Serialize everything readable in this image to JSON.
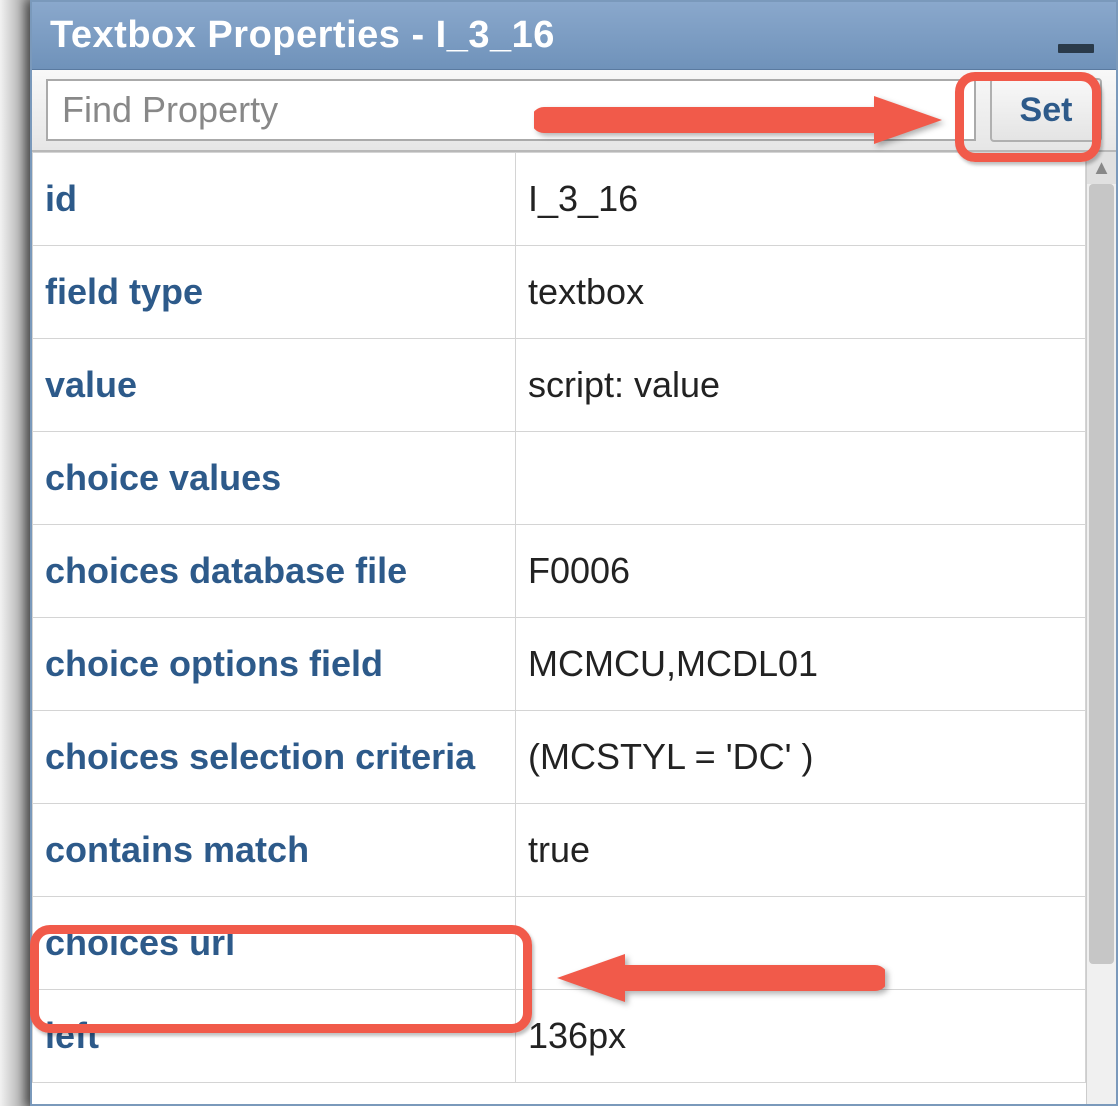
{
  "window": {
    "title": "Textbox Properties - I_3_16"
  },
  "toolbar": {
    "find_placeholder": "Find Property",
    "set_label": "Set"
  },
  "properties": [
    {
      "name": "id",
      "value": "I_3_16"
    },
    {
      "name": "field type",
      "value": "textbox"
    },
    {
      "name": "value",
      "value": "script: value"
    },
    {
      "name": "choice values",
      "value": ""
    },
    {
      "name": "choices database file",
      "value": "F0006"
    },
    {
      "name": "choice options field",
      "value": "MCMCU,MCDL01"
    },
    {
      "name": "choices selection criteria",
      "value": "(MCSTYL = 'DC' )"
    },
    {
      "name": "contains match",
      "value": "true"
    },
    {
      "name": "choices url",
      "value": ""
    },
    {
      "name": "left",
      "value": "136px"
    }
  ]
}
